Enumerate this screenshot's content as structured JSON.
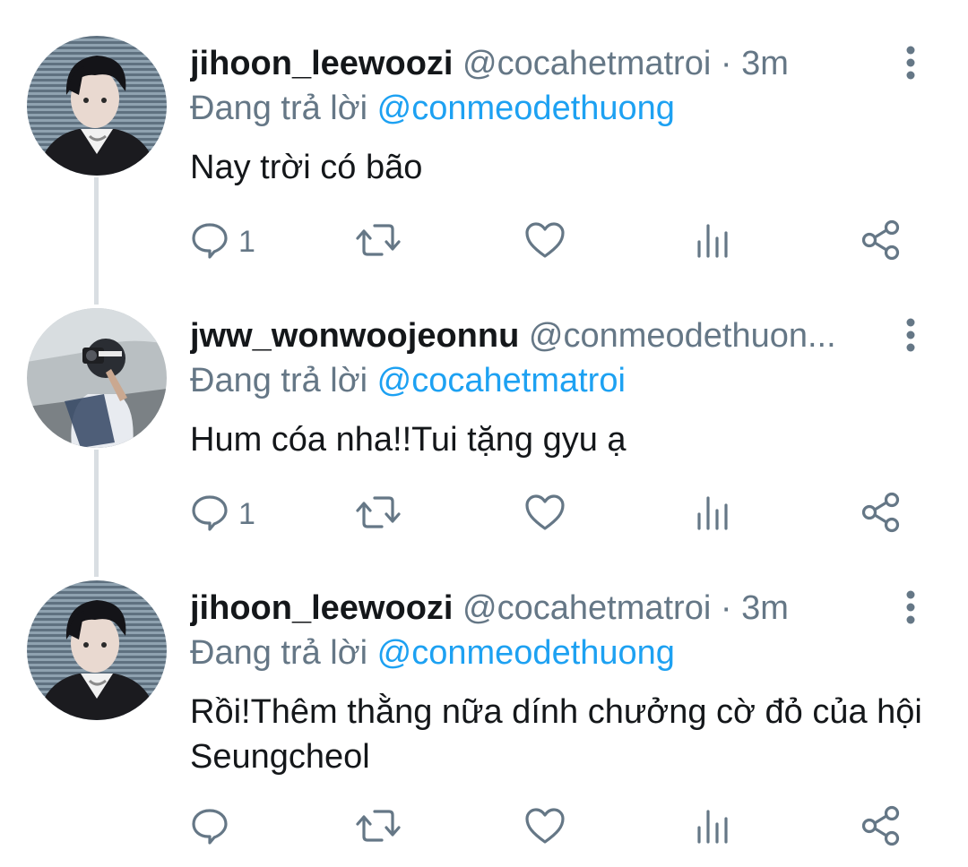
{
  "colors": {
    "accent": "#1da1f2",
    "muted": "#657786",
    "text": "#14171a",
    "thread_line": "#d9dee2"
  },
  "tweets": [
    {
      "display_name": "jihoon_leewoozi",
      "handle": "@cocahetmatroi",
      "separator": "·",
      "time": "3m",
      "reply_prefix": "Đang trả lời",
      "reply_to": "@conmeodethuong",
      "text": "Nay trời có bão",
      "reply_count": "1",
      "icons": [
        "reply-icon",
        "retweet-icon",
        "like-icon",
        "analytics-icon",
        "share-icon",
        "more-vertical-icon"
      ]
    },
    {
      "display_name": "jww_wonwoojeonnu",
      "handle": "@conmeodethuon...",
      "separator": "",
      "time": "",
      "reply_prefix": "Đang trả lời",
      "reply_to": "@cocahetmatroi",
      "text": "Hum cóa nha!!Tui tặng gyu ạ",
      "reply_count": "1",
      "icons": [
        "reply-icon",
        "retweet-icon",
        "like-icon",
        "analytics-icon",
        "share-icon",
        "more-vertical-icon"
      ]
    },
    {
      "display_name": "jihoon_leewoozi",
      "handle": "@cocahetmatroi",
      "separator": "·",
      "time": "3m",
      "reply_prefix": "Đang trả lời",
      "reply_to": "@conmeodethuong",
      "text": "Rồi!Thêm thằng nữa dính chưởng cờ đỏ của hội Seungcheol",
      "reply_count": "",
      "icons": [
        "reply-icon",
        "retweet-icon",
        "like-icon",
        "analytics-icon",
        "share-icon",
        "more-vertical-icon"
      ]
    }
  ]
}
